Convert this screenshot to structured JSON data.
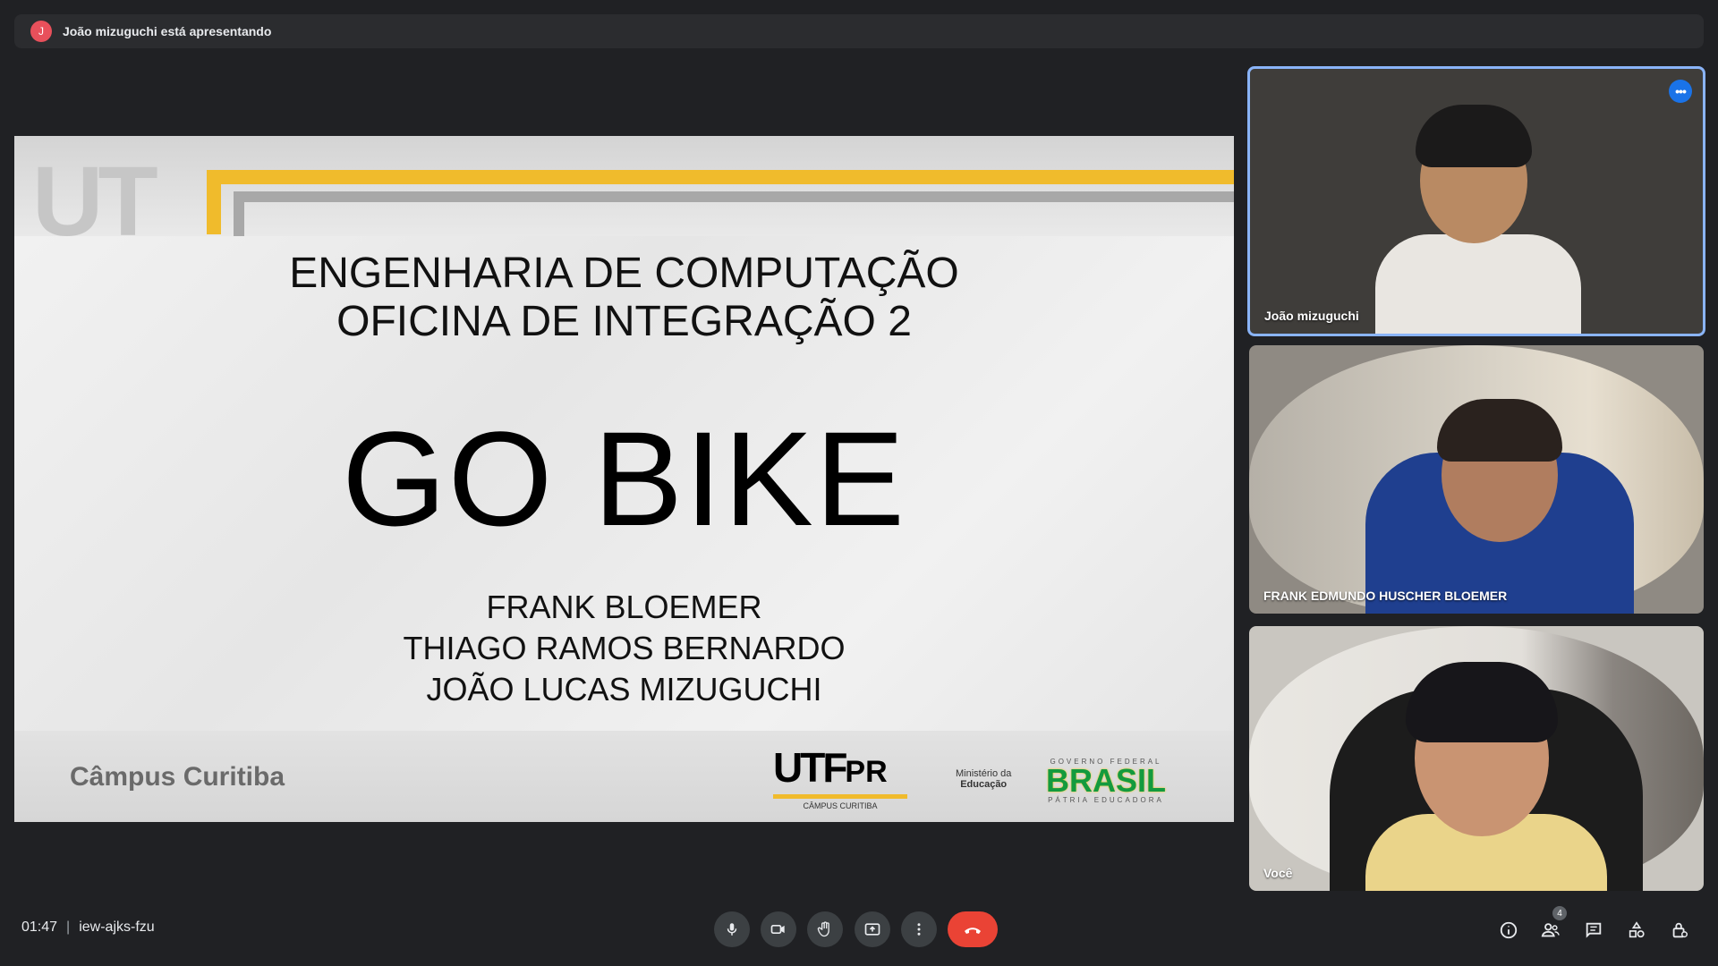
{
  "banner": {
    "avatar_initial": "J",
    "text": "João mizuguchi está apresentando"
  },
  "slide": {
    "course_line1": "ENGENHARIA DE COMPUTAÇÃO",
    "course_line2": "OFICINA DE INTEGRAÇÃO 2",
    "title": "GO BIKE",
    "names": [
      "FRANK BLOEMER",
      "THIAGO RAMOS BERNARDO",
      "JOÃO LUCAS MIZUGUCHI"
    ],
    "campus": "Câmpus Curitiba",
    "utfpr_logo": "UTFPR",
    "utfpr_sub": "CÂMPUS CURITIBA",
    "mec_line1": "Ministério da",
    "mec_line2": "Educação",
    "gov_top": "GOVERNO FEDERAL",
    "brasil": "BRASIL",
    "gov_bottom": "PÁTRIA EDUCADORA"
  },
  "participants": [
    {
      "name": "João mizuguchi",
      "active": true
    },
    {
      "name": "FRANK EDMUNDO HUSCHER BLOEMER"
    },
    {
      "name": "Você"
    }
  ],
  "footer": {
    "time": "01:47",
    "separator": "|",
    "meeting_code": "iew-ajks-fzu",
    "people_count": "4"
  },
  "colors": {
    "accent": "#8ab4f8",
    "end_call": "#ea4335",
    "bg": "#202124",
    "control_bg": "#3c4043"
  },
  "icons": [
    "microphone-icon",
    "camera-icon",
    "raise-hand-icon",
    "present-icon",
    "more-options-icon",
    "end-call-icon",
    "info-icon",
    "people-icon",
    "chat-icon",
    "activities-icon",
    "host-controls-icon"
  ]
}
